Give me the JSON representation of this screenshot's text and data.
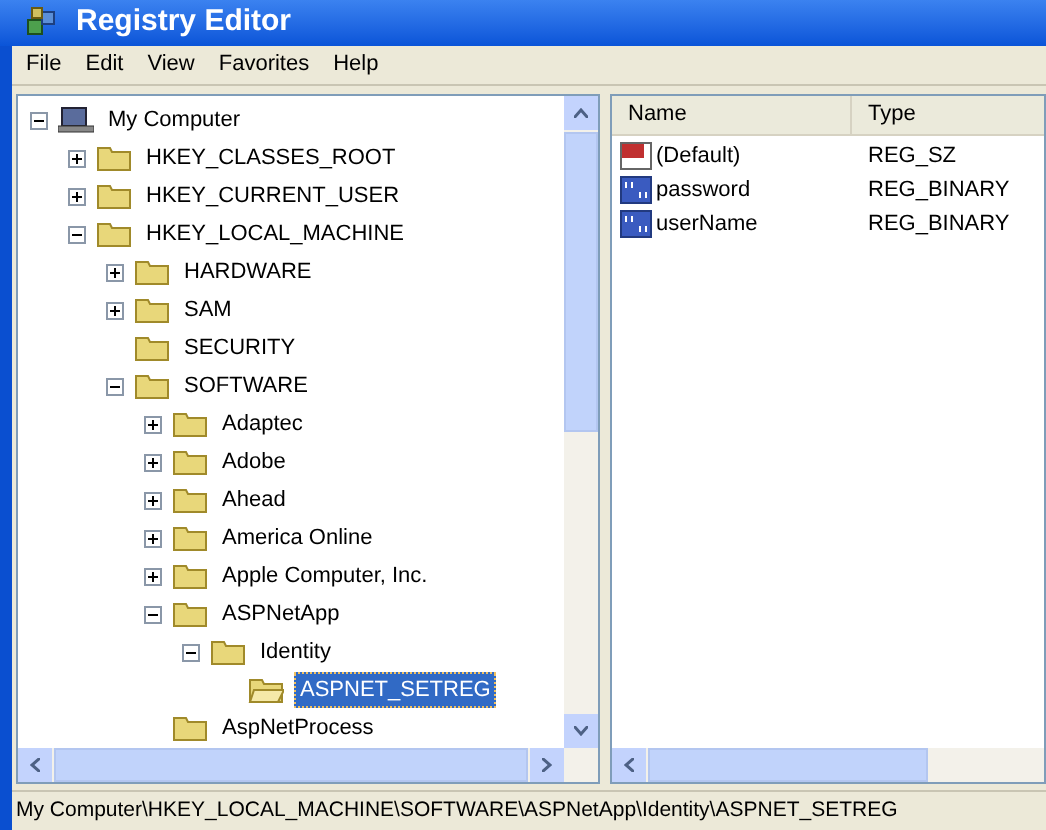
{
  "window": {
    "title": "Registry Editor"
  },
  "menu": [
    "File",
    "Edit",
    "View",
    "Favorites",
    "Help"
  ],
  "tree": [
    {
      "label": "My Computer",
      "kind": "computer",
      "expanded": true,
      "selected": false,
      "children": [
        {
          "label": "HKEY_CLASSES_ROOT",
          "kind": "folder",
          "expanded": false,
          "selected": false
        },
        {
          "label": "HKEY_CURRENT_USER",
          "kind": "folder",
          "expanded": false,
          "selected": false
        },
        {
          "label": "HKEY_LOCAL_MACHINE",
          "kind": "folder",
          "expanded": true,
          "selected": false,
          "children": [
            {
              "label": "HARDWARE",
              "kind": "folder",
              "expanded": false,
              "selected": false
            },
            {
              "label": "SAM",
              "kind": "folder",
              "expanded": false,
              "selected": false
            },
            {
              "label": "SECURITY",
              "kind": "folder",
              "selected": false
            },
            {
              "label": "SOFTWARE",
              "kind": "folder",
              "expanded": true,
              "selected": false,
              "children": [
                {
                  "label": "Adaptec",
                  "kind": "folder",
                  "expanded": false,
                  "selected": false
                },
                {
                  "label": "Adobe",
                  "kind": "folder",
                  "expanded": false,
                  "selected": false
                },
                {
                  "label": "Ahead",
                  "kind": "folder",
                  "expanded": false,
                  "selected": false
                },
                {
                  "label": "America Online",
                  "kind": "folder",
                  "expanded": false,
                  "selected": false
                },
                {
                  "label": "Apple Computer, Inc.",
                  "kind": "folder",
                  "expanded": false,
                  "selected": false
                },
                {
                  "label": "ASPNetApp",
                  "kind": "folder",
                  "expanded": true,
                  "selected": false,
                  "children": [
                    {
                      "label": "Identity",
                      "kind": "folder",
                      "expanded": true,
                      "selected": false,
                      "children": [
                        {
                          "label": "ASPNET_SETREG",
                          "kind": "folder",
                          "selected": true
                        }
                      ]
                    }
                  ]
                },
                {
                  "label": "AspNetProcess",
                  "kind": "folder",
                  "selected": false
                }
              ]
            }
          ]
        }
      ]
    }
  ],
  "values": {
    "columns": [
      "Name",
      "Type"
    ],
    "rows": [
      {
        "kind": "string",
        "name": "(Default)",
        "type": "REG_SZ"
      },
      {
        "kind": "binary",
        "name": "password",
        "type": "REG_BINARY"
      },
      {
        "kind": "binary",
        "name": "userName",
        "type": "REG_BINARY"
      }
    ]
  },
  "status_bar": "My Computer\\HKEY_LOCAL_MACHINE\\SOFTWARE\\ASPNetApp\\Identity\\ASPNET_SETREG"
}
